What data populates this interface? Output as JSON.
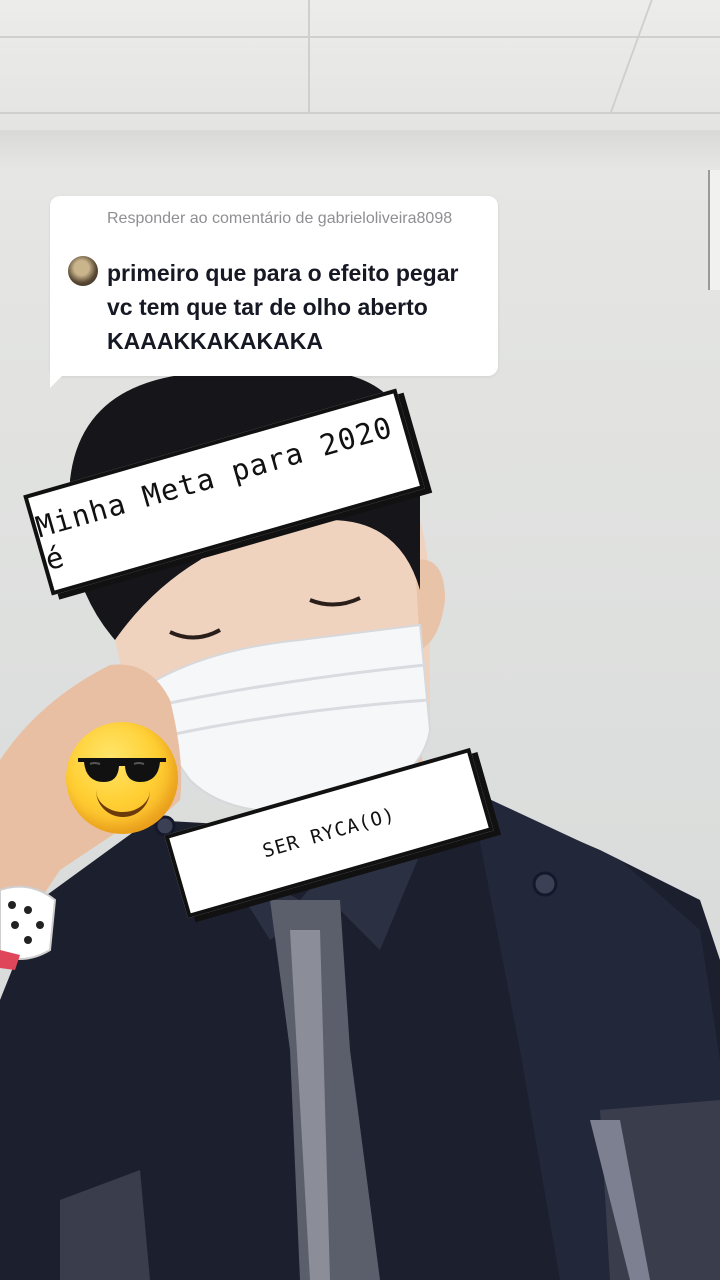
{
  "reply": {
    "header": "Responder ao comentário de gabrieloliveira8098",
    "text": "primeiro que para o efeito pegar vc tem que tar de olho aberto KAAAKKAKAKAKA"
  },
  "stickers": {
    "banner_top": "Minha Meta para 2020 é",
    "banner_bottom": "SER RYCA(O)",
    "emoji": "smiling-face-with-sunglasses"
  },
  "colors": {
    "bubble_bg": "#ffffff",
    "reply_text": "#161823",
    "reply_header": "#8f8f93",
    "banner_border": "#111111"
  }
}
